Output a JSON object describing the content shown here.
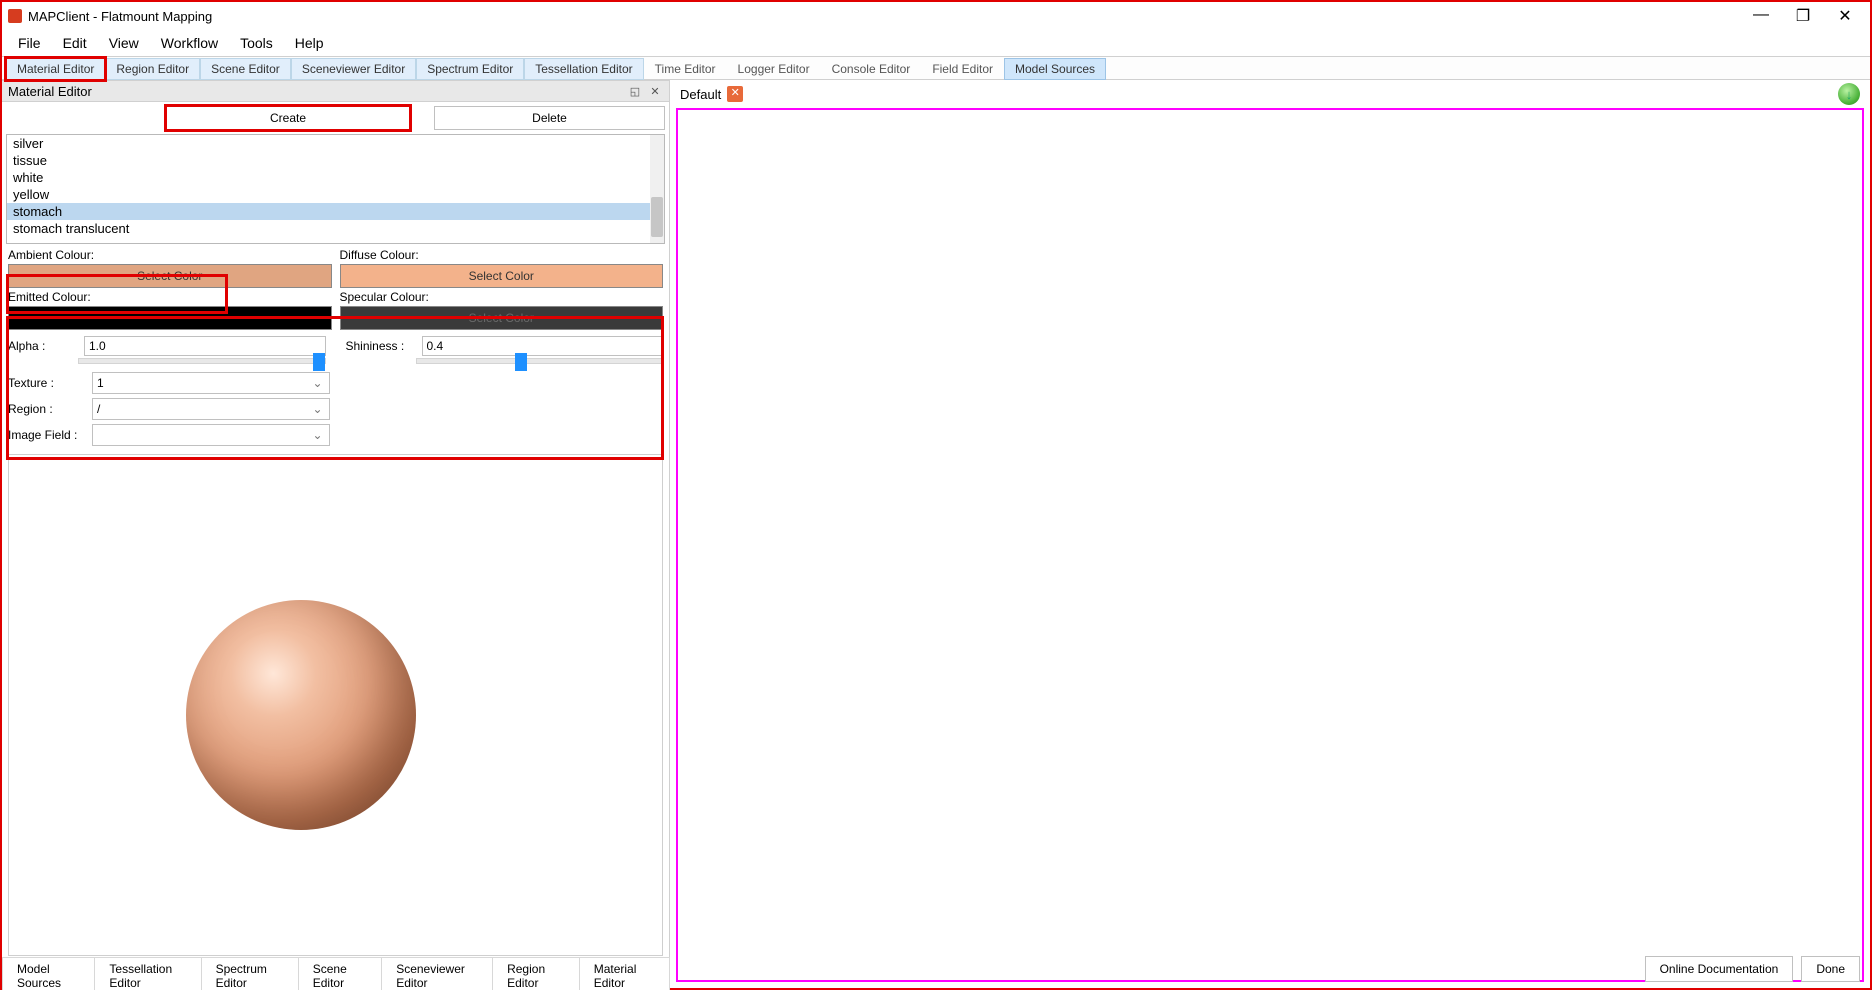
{
  "window": {
    "title": "MAPClient - Flatmount Mapping"
  },
  "menubar": [
    "File",
    "Edit",
    "View",
    "Workflow",
    "Tools",
    "Help"
  ],
  "editor_tabs": {
    "highlighted": [
      "Material Editor",
      "Region Editor",
      "Scene Editor",
      "Sceneviewer Editor",
      "Spectrum Editor",
      "Tessellation Editor"
    ],
    "plain": [
      "Time Editor",
      "Logger Editor",
      "Console Editor",
      "Field Editor"
    ],
    "model_sources": "Model Sources"
  },
  "material_editor": {
    "header": "Material Editor",
    "create_label": "Create",
    "delete_label": "Delete",
    "list": [
      "silver",
      "tissue",
      "white",
      "yellow",
      "stomach",
      "stomach translucent"
    ],
    "selected_index": 4,
    "ambient_label": "Ambient Colour:",
    "diffuse_label": "Diffuse Colour:",
    "emitted_label": "Emitted Colour:",
    "specular_label": "Specular Colour:",
    "select_color_label": "Select Color",
    "alpha_label": "Alpha :",
    "alpha_value": "1.0",
    "shininess_label": "Shininess :",
    "shininess_value": "0.4",
    "texture_label": "Texture :",
    "texture_value": "1",
    "region_label": "Region :",
    "region_value": "/",
    "imagefield_label": "Image Field :",
    "imagefield_value": ""
  },
  "bottom_tabs": [
    "Model Sources",
    "Tessellation Editor",
    "Spectrum Editor",
    "Scene Editor",
    "Sceneviewer Editor",
    "Region Editor",
    "Material Editor"
  ],
  "right": {
    "tab_label": "Default"
  },
  "footer": {
    "docs": "Online Documentation",
    "done": "Done"
  }
}
